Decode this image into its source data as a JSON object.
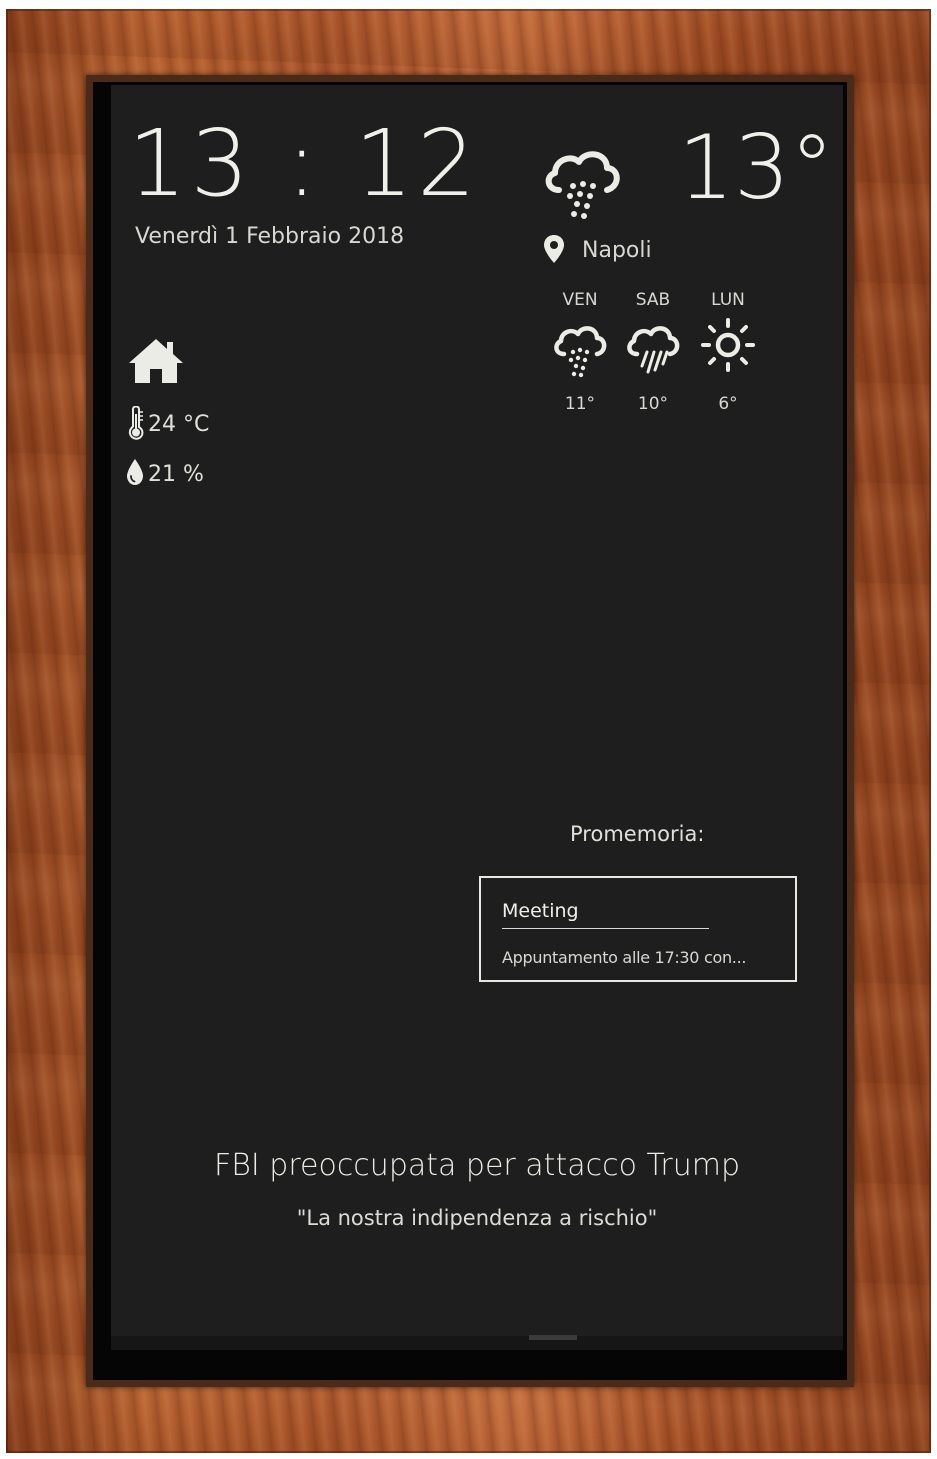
{
  "clock": {
    "time": "13 : 12",
    "date": "Venerdì 1 Febbraio 2018"
  },
  "weather": {
    "current_temp": "13°",
    "current_icon": "rain-cloud-icon",
    "city": "Napoli",
    "forecast": [
      {
        "day": "VEN",
        "icon": "rain-cloud-icon",
        "temp": "11°"
      },
      {
        "day": "SAB",
        "icon": "heavy-rain-cloud-icon",
        "temp": "10°"
      },
      {
        "day": "LUN",
        "icon": "sun-icon",
        "temp": "6°"
      }
    ]
  },
  "indoor": {
    "icon": "home-icon",
    "temperature": "24 °C",
    "humidity": "21 %"
  },
  "reminders": {
    "title": "Promemoria:",
    "items": [
      {
        "name": "Meeting",
        "description": "Appuntamento alle 17:30 con..."
      }
    ]
  },
  "news": {
    "headline": "FBI preoccupata per attacco Trump",
    "subheadline": "\"La nostra indipendenza a rischio\""
  },
  "colors": {
    "frame_wood": "#a9542a",
    "screen_bg": "#1e1e1e",
    "text": "#e8e8e2"
  }
}
